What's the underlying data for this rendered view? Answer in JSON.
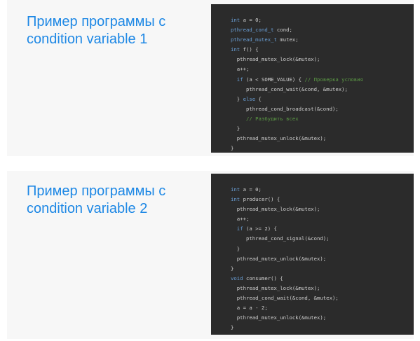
{
  "slides": [
    {
      "title": "Пример программы с condition variable 1",
      "code_lines": [
        [
          {
            "t": "int",
            "c": "kw"
          },
          {
            "t": " a = 0;",
            "c": "plain"
          }
        ],
        [
          {
            "t": "pthread_cond_t",
            "c": "kw"
          },
          {
            "t": " cond;",
            "c": "plain"
          }
        ],
        [
          {
            "t": "pthread_mutex_t",
            "c": "kw"
          },
          {
            "t": " mutex;",
            "c": "plain"
          }
        ],
        [
          {
            "t": "int",
            "c": "kw"
          },
          {
            "t": " f() {",
            "c": "plain"
          }
        ],
        [
          {
            "t": "  pthread_mutex_lock(&mutex);",
            "c": "plain"
          }
        ],
        [
          {
            "t": "  a++;",
            "c": "plain"
          }
        ],
        [
          {
            "t": "  ",
            "c": "plain"
          },
          {
            "t": "if",
            "c": "kw"
          },
          {
            "t": " (a < SOME_VALUE) { ",
            "c": "plain"
          },
          {
            "t": "// Проверка условия",
            "c": "cm"
          }
        ],
        [
          {
            "t": "     pthread_cond_wait(&cond, &mutex);",
            "c": "plain"
          }
        ],
        [
          {
            "t": "  } ",
            "c": "plain"
          },
          {
            "t": "else",
            "c": "kw"
          },
          {
            "t": " {",
            "c": "plain"
          }
        ],
        [
          {
            "t": "     pthread_cond_broadcast(&cond);",
            "c": "plain"
          }
        ],
        [
          {
            "t": "     ",
            "c": "plain"
          },
          {
            "t": "// Разбудить всех",
            "c": "cm"
          }
        ],
        [
          {
            "t": "  }",
            "c": "plain"
          }
        ],
        [
          {
            "t": "  pthread_mutex_unlock(&mutex);",
            "c": "plain"
          }
        ],
        [
          {
            "t": "}",
            "c": "plain"
          }
        ]
      ]
    },
    {
      "title": "Пример программы с condition variable 2",
      "code_lines": [
        [
          {
            "t": "int",
            "c": "kw"
          },
          {
            "t": " a = 0;",
            "c": "plain"
          }
        ],
        [
          {
            "t": "int",
            "c": "kw"
          },
          {
            "t": " producer() {",
            "c": "plain"
          }
        ],
        [
          {
            "t": "  pthread_mutex_lock(&mutex);",
            "c": "plain"
          }
        ],
        [
          {
            "t": "  a++;",
            "c": "plain"
          }
        ],
        [
          {
            "t": "  ",
            "c": "plain"
          },
          {
            "t": "if",
            "c": "kw"
          },
          {
            "t": " (a >= 2) {",
            "c": "plain"
          }
        ],
        [
          {
            "t": "     pthread_cond_signal(&cond);",
            "c": "plain"
          }
        ],
        [
          {
            "t": "  }",
            "c": "plain"
          }
        ],
        [
          {
            "t": "  pthread_mutex_unlock(&mutex);",
            "c": "plain"
          }
        ],
        [
          {
            "t": "}",
            "c": "plain"
          }
        ],
        [
          {
            "t": "void",
            "c": "kw"
          },
          {
            "t": " consumer() {",
            "c": "plain"
          }
        ],
        [
          {
            "t": "  pthread_mutex_lock(&mutex);",
            "c": "plain"
          }
        ],
        [
          {
            "t": "  pthread_cond_wait(&cond, &mutex);",
            "c": "plain"
          }
        ],
        [
          {
            "t": "  a = a - 2;",
            "c": "plain"
          }
        ],
        [
          {
            "t": "  pthread_mutex_unlock(&mutex);",
            "c": "plain"
          }
        ],
        [
          {
            "t": "}",
            "c": "plain"
          }
        ]
      ]
    }
  ],
  "colors": {
    "title": "#1e88e5",
    "code_bg": "#2b2b2b",
    "keyword": "#6a9fd6",
    "comment": "#5c9a45",
    "text": "#d0d0d0"
  }
}
